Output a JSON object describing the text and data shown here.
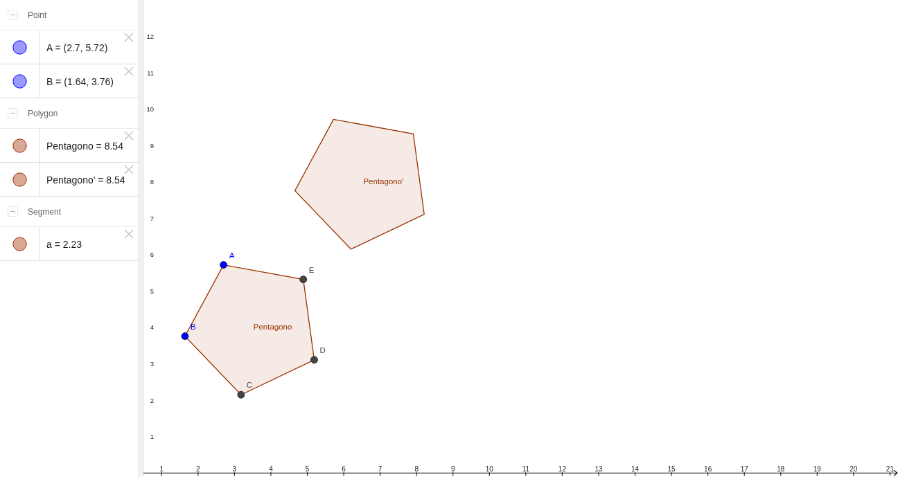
{
  "algebra_view": {
    "groups": [
      {
        "title": "Point",
        "expanded": true,
        "items": [
          {
            "text": "A = (2.7, 5.72)",
            "color": "#9999ff"
          },
          {
            "text": "B = (1.64, 3.76)",
            "color": "#9999ff"
          }
        ]
      },
      {
        "title": "Polygon",
        "expanded": true,
        "items": [
          {
            "text": "Pentagono = 8.54",
            "color": "#d8aa95"
          },
          {
            "text": "Pentagono' = 8.54",
            "color": "#d8aa95"
          }
        ]
      },
      {
        "title": "Segment",
        "expanded": true,
        "items": [
          {
            "text": "a = 2.23",
            "color": "#d8aa95"
          }
        ]
      }
    ]
  },
  "graphics_view": {
    "chart_data": {
      "type": "scatter",
      "xlim": [
        0.5,
        21.22
      ],
      "ylim": [
        -0.11,
        13.0
      ],
      "xticks": [
        1,
        2,
        3,
        4,
        5,
        6,
        7,
        8,
        9,
        10,
        11,
        12,
        13,
        14,
        15,
        16,
        17,
        18,
        19,
        20,
        21
      ],
      "yticks": [
        1,
        2,
        3,
        4,
        5,
        6,
        7,
        8,
        9,
        10,
        11,
        12
      ],
      "series": [
        {
          "name": "Pentagono",
          "type": "area",
          "color": "#993300",
          "x": [
            2.7,
            1.64,
            3.18,
            5.19,
            4.89
          ],
          "values": [
            5.72,
            3.76,
            2.15,
            3.11,
            5.32
          ]
        },
        {
          "name": "Pentagono'",
          "type": "area",
          "color": "#993300",
          "x": [
            5.72,
            4.66,
            6.2,
            8.21,
            7.91
          ],
          "values": [
            9.72,
            7.76,
            6.15,
            7.11,
            9.32
          ]
        },
        {
          "name": "A",
          "color": "#0000ff",
          "x": [
            2.7
          ],
          "values": [
            5.72
          ]
        },
        {
          "name": "B",
          "color": "#0000ff",
          "x": [
            1.64
          ],
          "values": [
            3.76
          ]
        },
        {
          "name": "C",
          "color": "#444444",
          "x": [
            3.18
          ],
          "values": [
            2.15
          ]
        },
        {
          "name": "D",
          "color": "#444444",
          "x": [
            5.19
          ],
          "values": [
            3.11
          ]
        },
        {
          "name": "E",
          "color": "#444444",
          "x": [
            4.89
          ],
          "values": [
            5.32
          ]
        }
      ]
    }
  }
}
